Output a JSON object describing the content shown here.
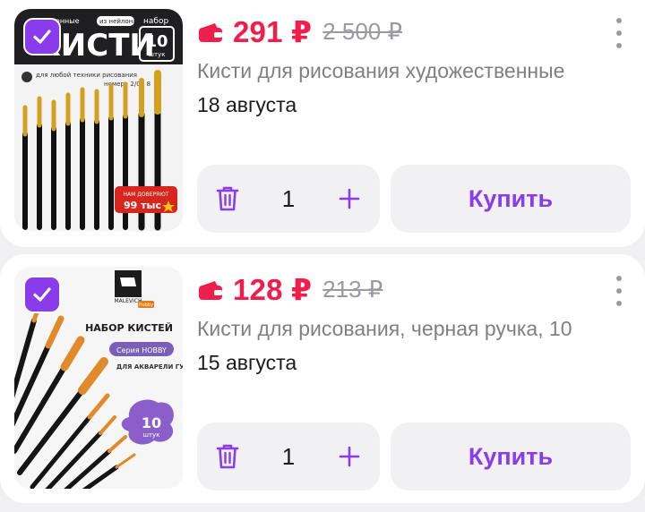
{
  "colors": {
    "accent": "#8a3bea",
    "price": "#f01e4b",
    "muted": "#9a9aa2"
  },
  "items": [
    {
      "price": "291 ₽",
      "old_price": "2 500 ₽",
      "title": "Кисти для рисования художественные",
      "delivery": "18 августа",
      "quantity": "1",
      "buy_label": "Купить",
      "image": {
        "badge": "из нейлона",
        "heading": "КИСТИ",
        "header_prefix": "жественные",
        "set_label": "набор",
        "set_count": "10",
        "set_unit": "штук",
        "technique": "для любой техники рисования",
        "numbers": "номера 2/0 - 8",
        "trust_top": "НАМ ДОВЕРЯЮТ",
        "trust_count": "99 тыс"
      }
    },
    {
      "price": "128 ₽",
      "old_price": "213 ₽",
      "title": "Кисти для рисования, черная ручка, 10",
      "delivery": "15 августа",
      "quantity": "1",
      "buy_label": "Купить",
      "image": {
        "brand": "MALEVICH",
        "brand_tag": "Hobby",
        "heading": "НАБОР КИСТЕЙ",
        "series": "Серия HOBBY",
        "uses": "ДЛЯ АКВАРЕЛИ ГУАШИ МАСЛА АКРИЛА ТЕМПЕРЫ",
        "count": "10",
        "count_unit": "штук"
      }
    }
  ]
}
